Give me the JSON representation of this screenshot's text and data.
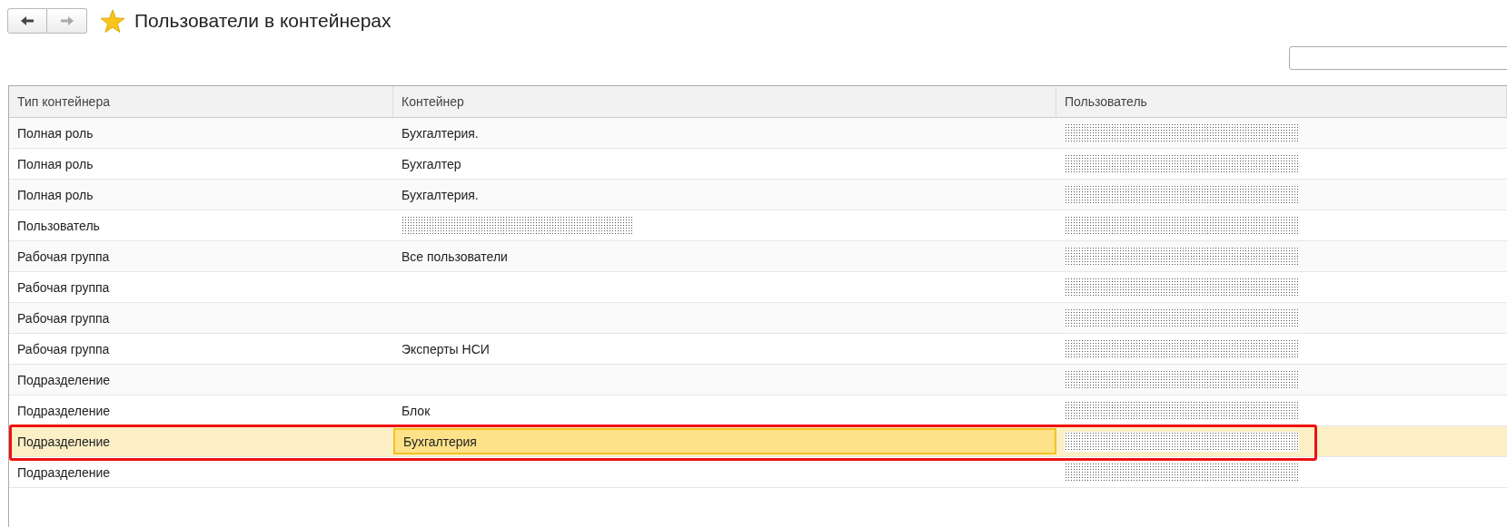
{
  "title": "Пользователи в контейнерах",
  "nav": {
    "back_disabled": false,
    "forward_disabled": true
  },
  "favorite": true,
  "table": {
    "columns": [
      "Тип контейнера",
      "Контейнер",
      "Пользователь"
    ],
    "rows": [
      {
        "type": "Полная роль",
        "container": "Бухгалтерия.",
        "container_redacted": false,
        "user_redacted": true,
        "selected": false
      },
      {
        "type": "Полная роль",
        "container": "Бухгалтер",
        "container_redacted": false,
        "user_redacted": true,
        "selected": false
      },
      {
        "type": "Полная роль",
        "container": "Бухгалтерия.",
        "container_redacted": false,
        "user_redacted": true,
        "selected": false
      },
      {
        "type": "Пользователь",
        "container_redacted": true,
        "user_redacted": true,
        "selected": false
      },
      {
        "type": "Рабочая группа",
        "container": "Все пользователи",
        "container_redacted": false,
        "user_redacted": true,
        "selected": false
      },
      {
        "type": "Рабочая группа",
        "container_redacted": false,
        "user_redacted": true,
        "selected": false
      },
      {
        "type": "Рабочая группа",
        "container_redacted": false,
        "user_redacted": true,
        "selected": false
      },
      {
        "type": "Рабочая группа",
        "container": "Эксперты НСИ",
        "container_redacted": false,
        "user_redacted": true,
        "selected": false
      },
      {
        "type": "Подразделение",
        "container_redacted": false,
        "user_redacted": true,
        "selected": false
      },
      {
        "type": "Подразделение",
        "container": "Блок",
        "container_redacted": false,
        "user_redacted": true,
        "selected": false
      },
      {
        "type": "Подразделение",
        "container": "Бухгалтерия",
        "container_redacted": false,
        "user_redacted": true,
        "selected": true
      },
      {
        "type": "Подразделение",
        "container_redacted": false,
        "user_redacted": true,
        "selected": false
      }
    ]
  }
}
